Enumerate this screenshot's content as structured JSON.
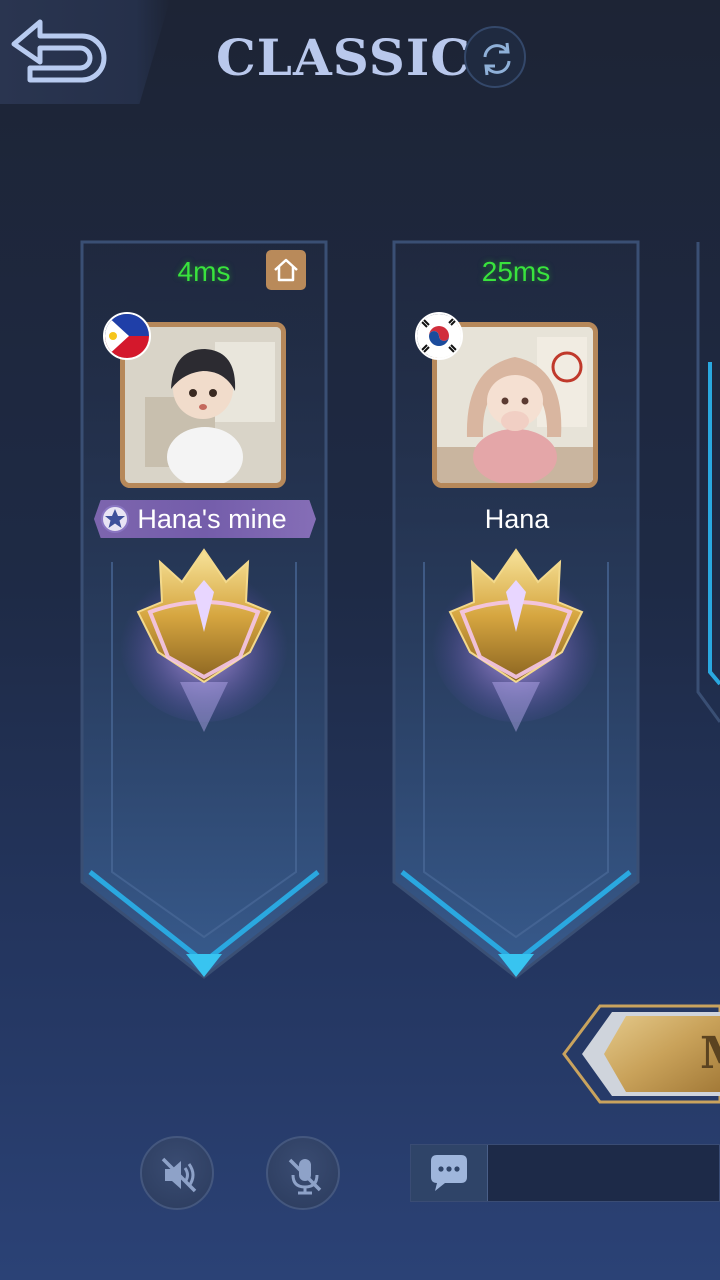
{
  "header": {
    "title": "CLASSIC"
  },
  "players": [
    {
      "ping": "4ms",
      "name": "Hana's mine",
      "flag": "philippines-flag",
      "host": true,
      "name_style": "special"
    },
    {
      "ping": "25ms",
      "name": "Hana",
      "flag": "south-korea-flag",
      "host": false,
      "name_style": "plain"
    }
  ],
  "ready_button": {
    "label": "M"
  },
  "controls": {
    "speaker_icon": "speaker-muted-icon",
    "mic_icon": "mic-muted-icon",
    "chat_icon": "chat-bubble-icon",
    "chat_placeholder": ""
  },
  "colors": {
    "ping": "#39e33d",
    "title": "#b9c8ec",
    "avatar_border": "#b6885a",
    "host_badge": "#b98a5a",
    "frame_glow": "#2aa8e0"
  }
}
